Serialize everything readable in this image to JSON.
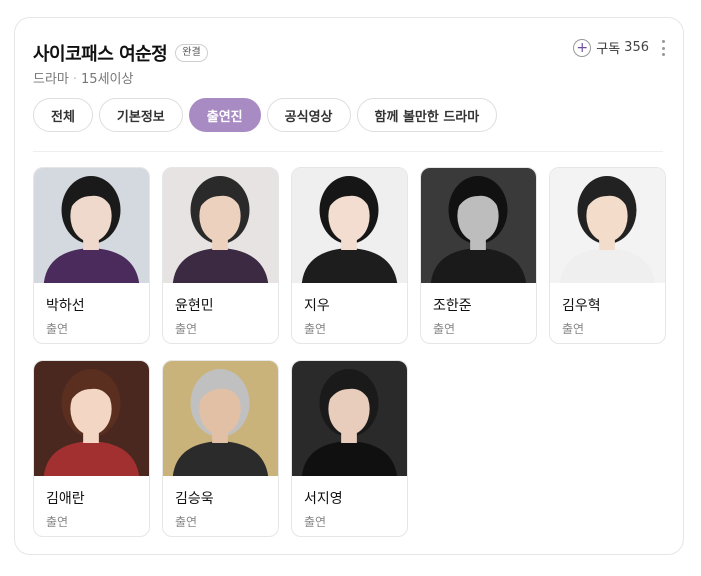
{
  "header": {
    "title": "사이코패스 여순정",
    "badge": "완결",
    "genre": "드라마",
    "rating": "15세이상",
    "subscribe_label": "구독",
    "subscribe_count": "356"
  },
  "tabs": [
    {
      "label": "전체",
      "active": false
    },
    {
      "label": "기본정보",
      "active": false
    },
    {
      "label": "출연진",
      "active": true
    },
    {
      "label": "공식영상",
      "active": false
    },
    {
      "label": "함께 볼만한 드라마",
      "active": false
    }
  ],
  "cast": [
    {
      "name": "박하선",
      "role": "출연",
      "bg": "#d4d8df",
      "hair": "#1a1a1a",
      "skin": "#efd9cc",
      "cloth": "#4a2b5c"
    },
    {
      "name": "윤현민",
      "role": "출연",
      "bg": "#e6e3e2",
      "hair": "#2a2a2a",
      "skin": "#ecd1bf",
      "cloth": "#3b2a42"
    },
    {
      "name": "지우",
      "role": "출연",
      "bg": "#f0efef",
      "hair": "#161616",
      "skin": "#f3ddd0",
      "cloth": "#1d1d1d"
    },
    {
      "name": "조한준",
      "role": "출연",
      "bg": "#3a3a3a",
      "hair": "#111111",
      "skin": "#bdbdbd",
      "cloth": "#1a1a1a"
    },
    {
      "name": "김우혁",
      "role": "출연",
      "bg": "#f3f3f3",
      "hair": "#222222",
      "skin": "#f4dccb",
      "cloth": "#efefef"
    },
    {
      "name": "김애란",
      "role": "출연",
      "bg": "#4a2820",
      "hair": "#5a2f1f",
      "skin": "#f3d6c4",
      "cloth": "#a23030"
    },
    {
      "name": "김승욱",
      "role": "출연",
      "bg": "#c9b37a",
      "hair": "#c0c0c0",
      "skin": "#e2c0a6",
      "cloth": "#2b2b2b"
    },
    {
      "name": "서지영",
      "role": "출연",
      "bg": "#2a2a2a",
      "hair": "#1a1a1a",
      "skin": "#e8cdbd",
      "cloth": "#101010"
    }
  ]
}
